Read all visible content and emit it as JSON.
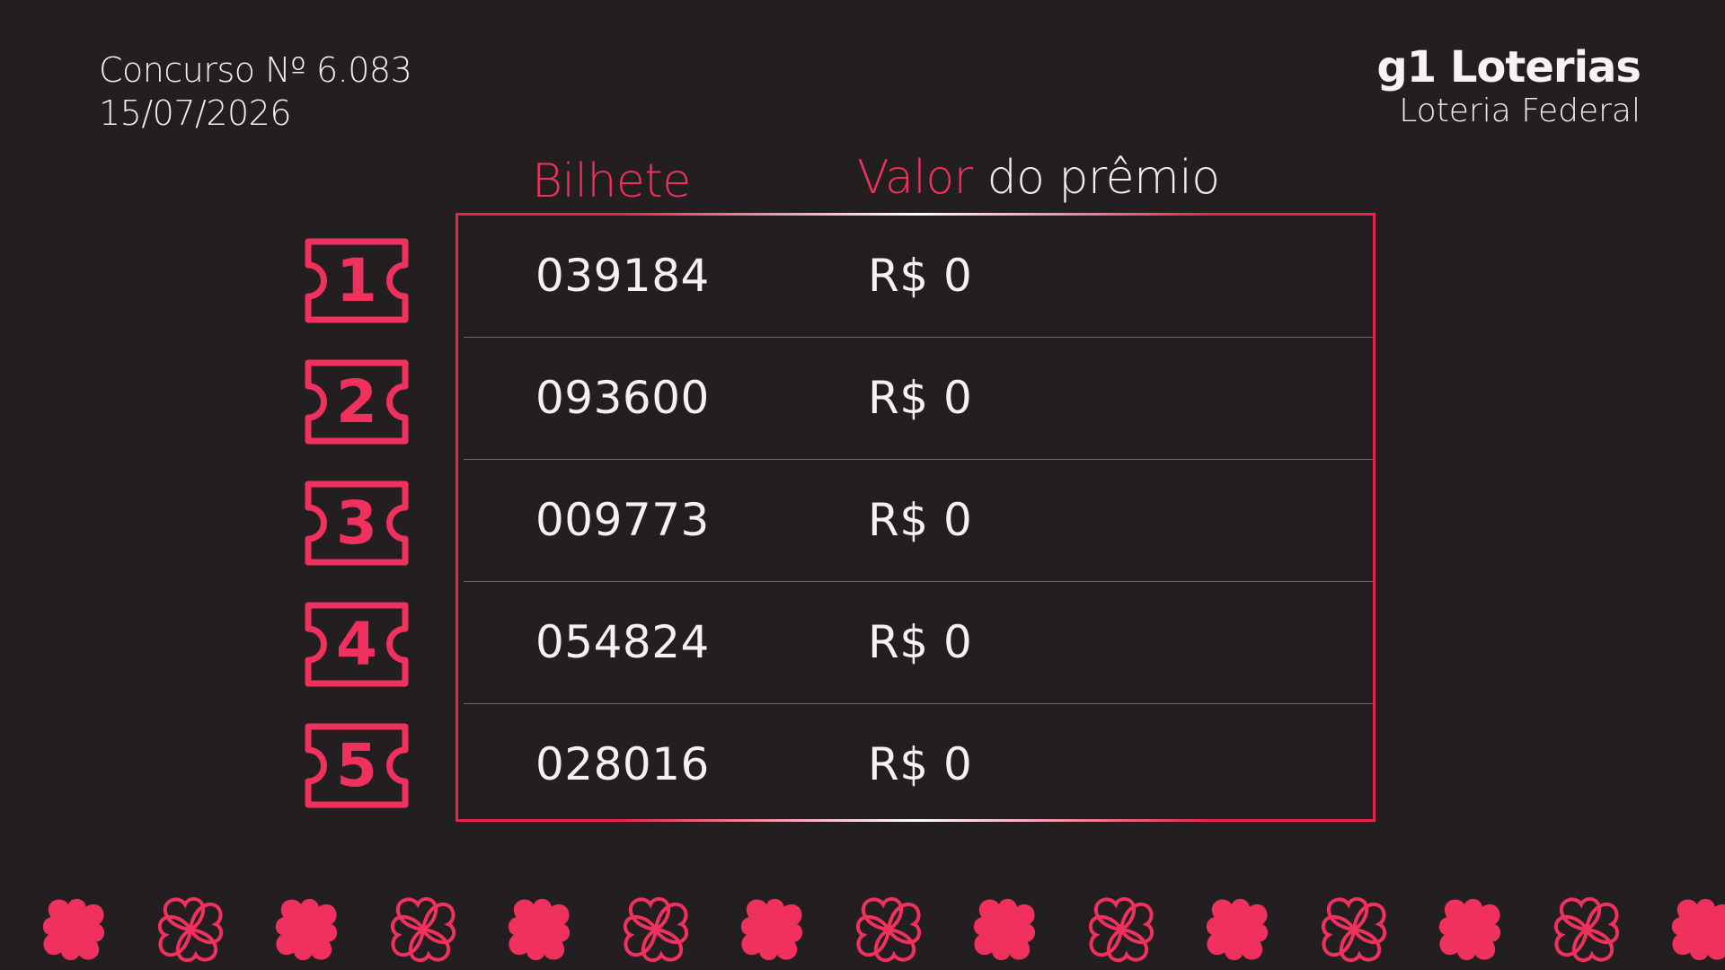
{
  "header": {
    "contest": "Concurso Nº 6.083",
    "date": "15/07/2026"
  },
  "brand": {
    "title": "g1 Loterias",
    "subtitle": "Loteria Federal"
  },
  "columns": {
    "ticket": "Bilhete",
    "prize_accent": "Valor",
    "prize_rest": " do prêmio"
  },
  "rows": [
    {
      "position": "1",
      "ticket": "039184",
      "prize": "R$ 0"
    },
    {
      "position": "2",
      "ticket": "093600",
      "prize": "R$ 0"
    },
    {
      "position": "3",
      "ticket": "009773",
      "prize": "R$ 0"
    },
    {
      "position": "4",
      "ticket": "054824",
      "prize": "R$ 0"
    },
    {
      "position": "5",
      "ticket": "028016",
      "prize": "R$ 0"
    }
  ],
  "colors": {
    "accent": "#f0315e",
    "background": "#231f20",
    "text": "#f4f1f1"
  },
  "icons": {
    "badge": "ticket-badge-icon",
    "clover": "clover-icon"
  }
}
